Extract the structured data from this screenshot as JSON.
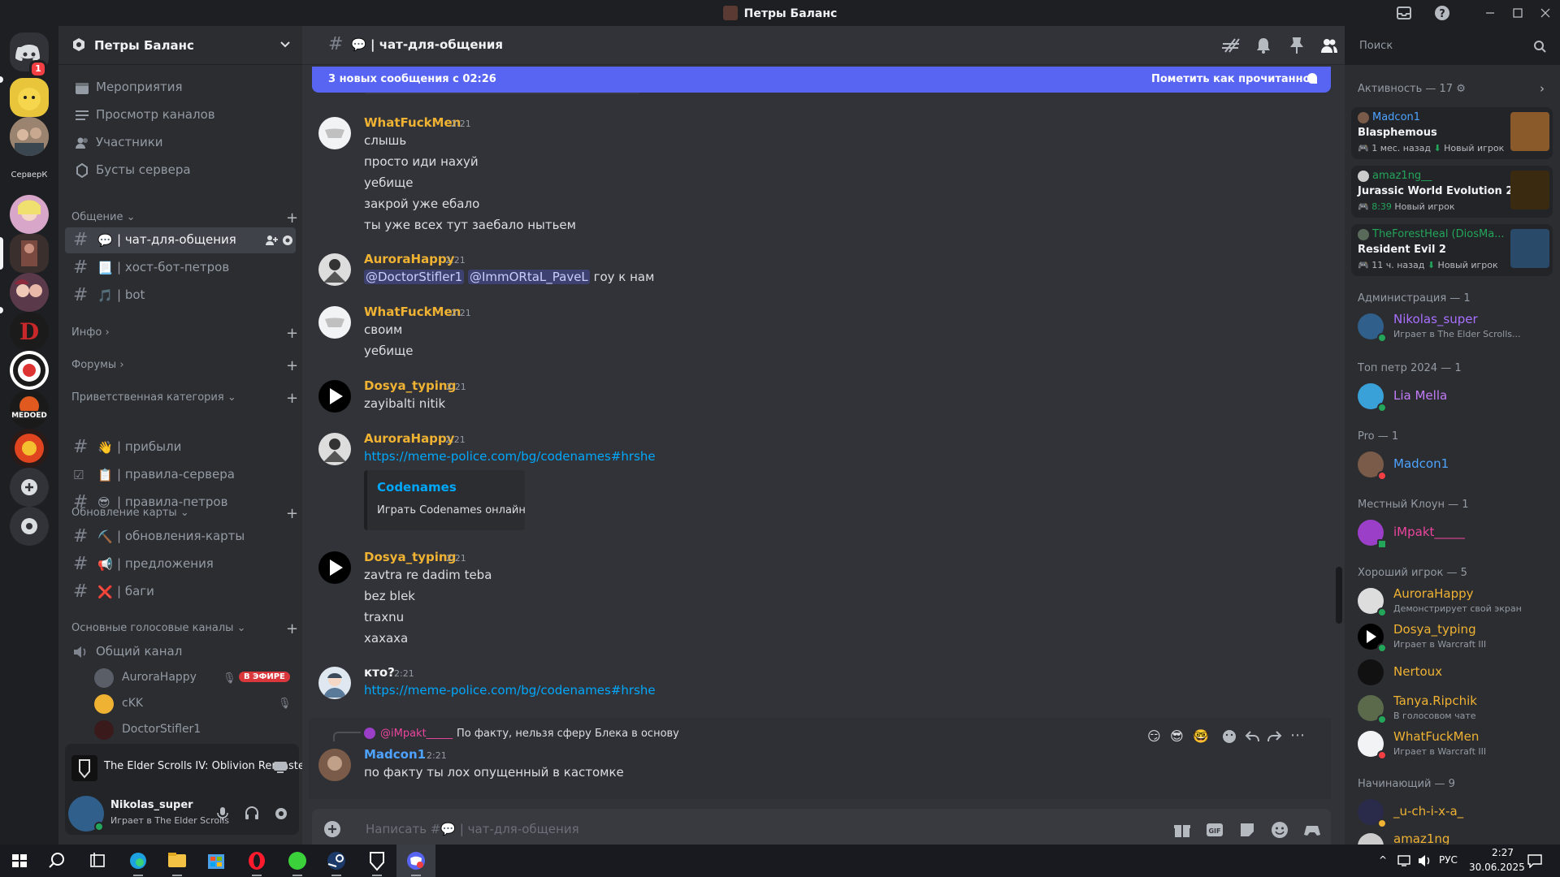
{
  "window": {
    "title": "Петры Баланс"
  },
  "server": {
    "name": "Петры Баланс"
  },
  "server_badge": "1",
  "nav": {
    "events": "Мероприятия",
    "browse": "Просмотр каналов",
    "members": "Участники",
    "boosts": "Бусты сервера"
  },
  "categories": {
    "chat": "Общение",
    "info": "Инфо",
    "forums": "Форумы",
    "welcome": "Приветственная категория",
    "map": "Обновление карты",
    "voice": "Основные голосовые каналы"
  },
  "channels": {
    "chat": [
      {
        "emoji": "💬",
        "name": "| чат-для-общения"
      },
      {
        "emoji": "📃",
        "name": "| хост-бот-петров"
      },
      {
        "emoji": "🎵",
        "name": "| bot"
      }
    ],
    "welcome": [
      {
        "emoji": "👋",
        "name": "| прибыли"
      },
      {
        "emoji": "📋",
        "name": "| правила-сервера"
      },
      {
        "emoji": "😎",
        "name": "| правила-петров"
      }
    ],
    "map": [
      {
        "emoji": "⛏️",
        "name": "| обновления-карты"
      },
      {
        "emoji": "📢",
        "name": "| предложения"
      },
      {
        "emoji": "❌",
        "name": "| баги"
      }
    ],
    "voice_channel": "Общий канал",
    "voice_users": [
      {
        "name": "AuroraHappy",
        "live": "В ЭФИРЕ"
      },
      {
        "name": "cKK"
      },
      {
        "name": "DoctorStifler1"
      }
    ]
  },
  "activity": {
    "game": "The Elder Scrolls IV: Oblivion Remastered"
  },
  "user": {
    "name": "Nikolas_super",
    "status": "Играет в The Elder Scrolls IV:"
  },
  "channel_header": {
    "emoji": "💬",
    "name": "| чат-для-общения",
    "search_placeholder": "Поиск"
  },
  "new_messages": {
    "text": "3 новых сообщения с 02:26",
    "mark_read": "Пометить как прочитанное"
  },
  "messages": [
    {
      "author": "WhatFuckMen",
      "color": "#f0b232",
      "time": "2:21",
      "lines": [
        "слышь",
        "просто иди нахуй",
        "уебище",
        "закрой уже ебало",
        "ты уже всех тут заебало нытьем"
      ]
    },
    {
      "author": "AuroraHappy",
      "color": "#f0b232",
      "time": "2:21",
      "mentions": [
        "@DoctorStifler1",
        "@ImmORtaL_PaveL"
      ],
      "text_after": "гоу к нам"
    },
    {
      "author": "WhatFuckMen",
      "color": "#f0b232",
      "time": "2:21",
      "lines": [
        "своим",
        "уебище"
      ]
    },
    {
      "author": "Dosya_typing",
      "color": "#f0b232",
      "time": "2:21",
      "lines": [
        "zayibalti nitik"
      ]
    },
    {
      "author": "AuroraHappy",
      "color": "#f0b232",
      "time": "2:21",
      "link": "https://meme-police.com/bg/codenames#hrshe",
      "embed_title": "Codenames",
      "embed_desc": "Играть Codenames онлайн"
    },
    {
      "author": "Dosya_typing",
      "color": "#f0b232",
      "time": "2:21",
      "lines": [
        "zavtra re dadim teba",
        "bez blek",
        "traxnu",
        "хахаха"
      ]
    },
    {
      "author": "кто?",
      "color": "#f2f3f5",
      "time": "2:21",
      "link": "https://meme-police.com/bg/codenames#hrshe"
    },
    {
      "author": "Madcon1",
      "color": "#4da3ff",
      "time": "2:21",
      "reply_to": "@iMpakt_____",
      "reply_text": "По факту, нельзя сферу Блека в основу",
      "lines": [
        "по факту ты лох опущенный в кастомке"
      ]
    }
  ],
  "composer": {
    "placeholder": "Написать #💬 | чат-для-общения"
  },
  "members_panel": {
    "activity_header": "Активность — 17",
    "activity_cards": [
      {
        "user": "Madcon1",
        "user_color": "#4da3ff",
        "game": "Blasphemous",
        "meta": "1 мес. назад",
        "tag": "Новый игрок"
      },
      {
        "user": "amaz1ng__",
        "user_color": "#23a55a",
        "game": "Jurassic World Evolution 2",
        "meta": "8:39",
        "tag": "Новый игрок"
      },
      {
        "user": "TheForestHeal (DiosMa...",
        "user_color": "#23a55a",
        "game": "Resident Evil 2",
        "meta": "11 ч. назад",
        "tag": "Новый игрок"
      }
    ],
    "groups": [
      {
        "header": "Администрация — 1",
        "members": [
          {
            "name": "Nikolas_super",
            "color": "#a970ff",
            "sub": "Играет в The Elder Scrolls...",
            "status": "online"
          }
        ]
      },
      {
        "header": "Топ петр 2024 — 1",
        "members": [
          {
            "name": "Lia Mella",
            "color": "#c27cf7",
            "status": "online"
          }
        ]
      },
      {
        "header": "Pro — 1",
        "members": [
          {
            "name": "Madcon1",
            "color": "#4da3ff",
            "status": "dnd"
          }
        ]
      },
      {
        "header": "Местный Клоун — 1",
        "members": [
          {
            "name": "iMpakt_____",
            "color": "#eb459e",
            "status": "mobile"
          }
        ]
      },
      {
        "header": "Хороший игрок — 5",
        "members": [
          {
            "name": "AuroraHappy",
            "color": "#f0b232",
            "sub": "Демонстрирует свой экран",
            "status": "online"
          },
          {
            "name": "Dosya_typing",
            "color": "#f0b232",
            "sub": "Играет в Warcraft III",
            "status": "online"
          },
          {
            "name": "Nertoux",
            "color": "#f0b232"
          },
          {
            "name": "Tanya.Ripchik",
            "color": "#f0b232",
            "sub": "В голосовом чате",
            "status": "online"
          },
          {
            "name": "WhatFuckMen",
            "color": "#f0b232",
            "sub": "Играет в Warcraft III",
            "status": "dnd"
          }
        ]
      },
      {
        "header": "Начинающий — 9",
        "members": [
          {
            "name": "_u-ch-i-x-a_",
            "color": "#f0b232",
            "status": "idle"
          },
          {
            "name": "amaz1ng",
            "color": "#f0b232"
          }
        ]
      }
    ]
  },
  "taskbar": {
    "lang": "РУС",
    "time": "2:27",
    "date": "30.06.2025"
  }
}
